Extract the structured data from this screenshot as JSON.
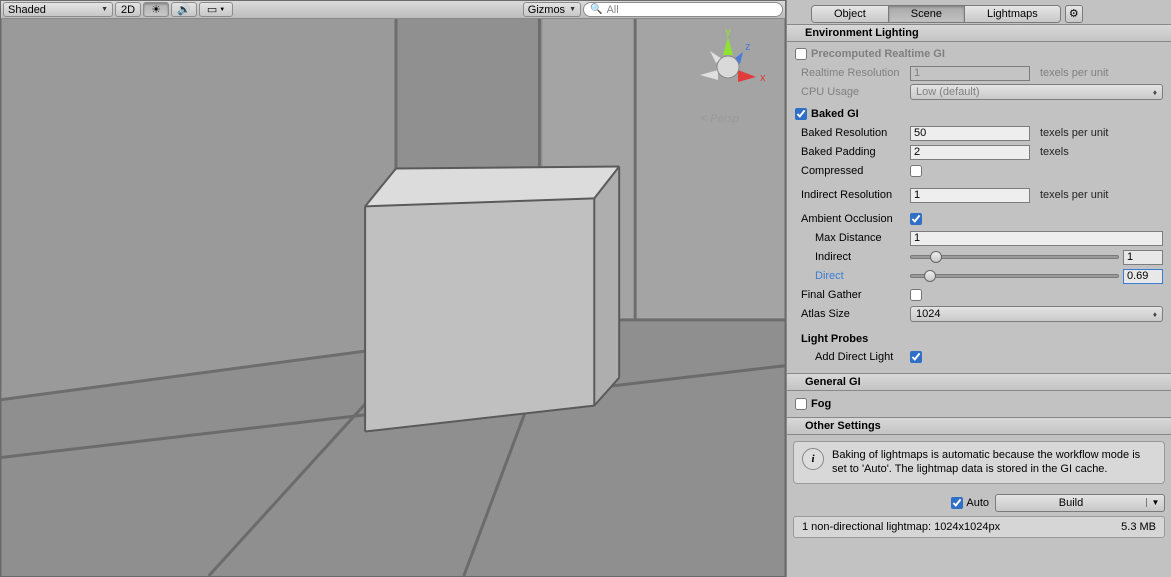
{
  "viewport": {
    "renderMode": "Shaded",
    "btn2D": "2D",
    "gizmos": "Gizmos",
    "searchPlaceholder": "All",
    "persp": "Persp",
    "axes": {
      "x": "x",
      "y": "y",
      "z": "z"
    }
  },
  "tabs": {
    "object": "Object",
    "scene": "Scene",
    "lightmaps": "Lightmaps"
  },
  "env": {
    "header": "Environment Lighting",
    "precomp": {
      "label": "Precomputed Realtime GI",
      "checked": false
    },
    "realtimeRes": {
      "label": "Realtime Resolution",
      "value": "1",
      "unit": "texels per unit"
    },
    "cpu": {
      "label": "CPU Usage",
      "value": "Low (default)"
    },
    "baked": {
      "label": "Baked GI",
      "checked": true
    },
    "bakedRes": {
      "label": "Baked Resolution",
      "value": "50",
      "unit": "texels per unit"
    },
    "bakedPad": {
      "label": "Baked Padding",
      "value": "2",
      "unit": "texels"
    },
    "compressed": {
      "label": "Compressed",
      "checked": false
    },
    "indirectRes": {
      "label": "Indirect Resolution",
      "value": "1",
      "unit": "texels per unit"
    },
    "ao": {
      "label": "Ambient Occlusion",
      "checked": true
    },
    "maxDist": {
      "label": "Max Distance",
      "value": "1"
    },
    "indirect": {
      "label": "Indirect",
      "value": "1",
      "pct": 12
    },
    "direct": {
      "label": "Direct",
      "value": "0.69",
      "pct": 9
    },
    "finalGather": {
      "label": "Final Gather",
      "checked": false
    },
    "atlas": {
      "label": "Atlas Size",
      "value": "1024"
    },
    "probes": {
      "header": "Light Probes",
      "addDirect": {
        "label": "Add Direct Light",
        "checked": true
      }
    }
  },
  "generalGI": {
    "header": "General GI"
  },
  "fog": {
    "label": "Fog",
    "checked": false
  },
  "other": {
    "header": "Other Settings"
  },
  "info": "Baking of lightmaps is automatic because the workflow mode is set to 'Auto'. The lightmap data is stored in the GI cache.",
  "build": {
    "auto": "Auto",
    "checked": true,
    "button": "Build"
  },
  "stats": {
    "text": "1 non-directional lightmap: 1024x1024px",
    "size": "5.3 MB"
  }
}
